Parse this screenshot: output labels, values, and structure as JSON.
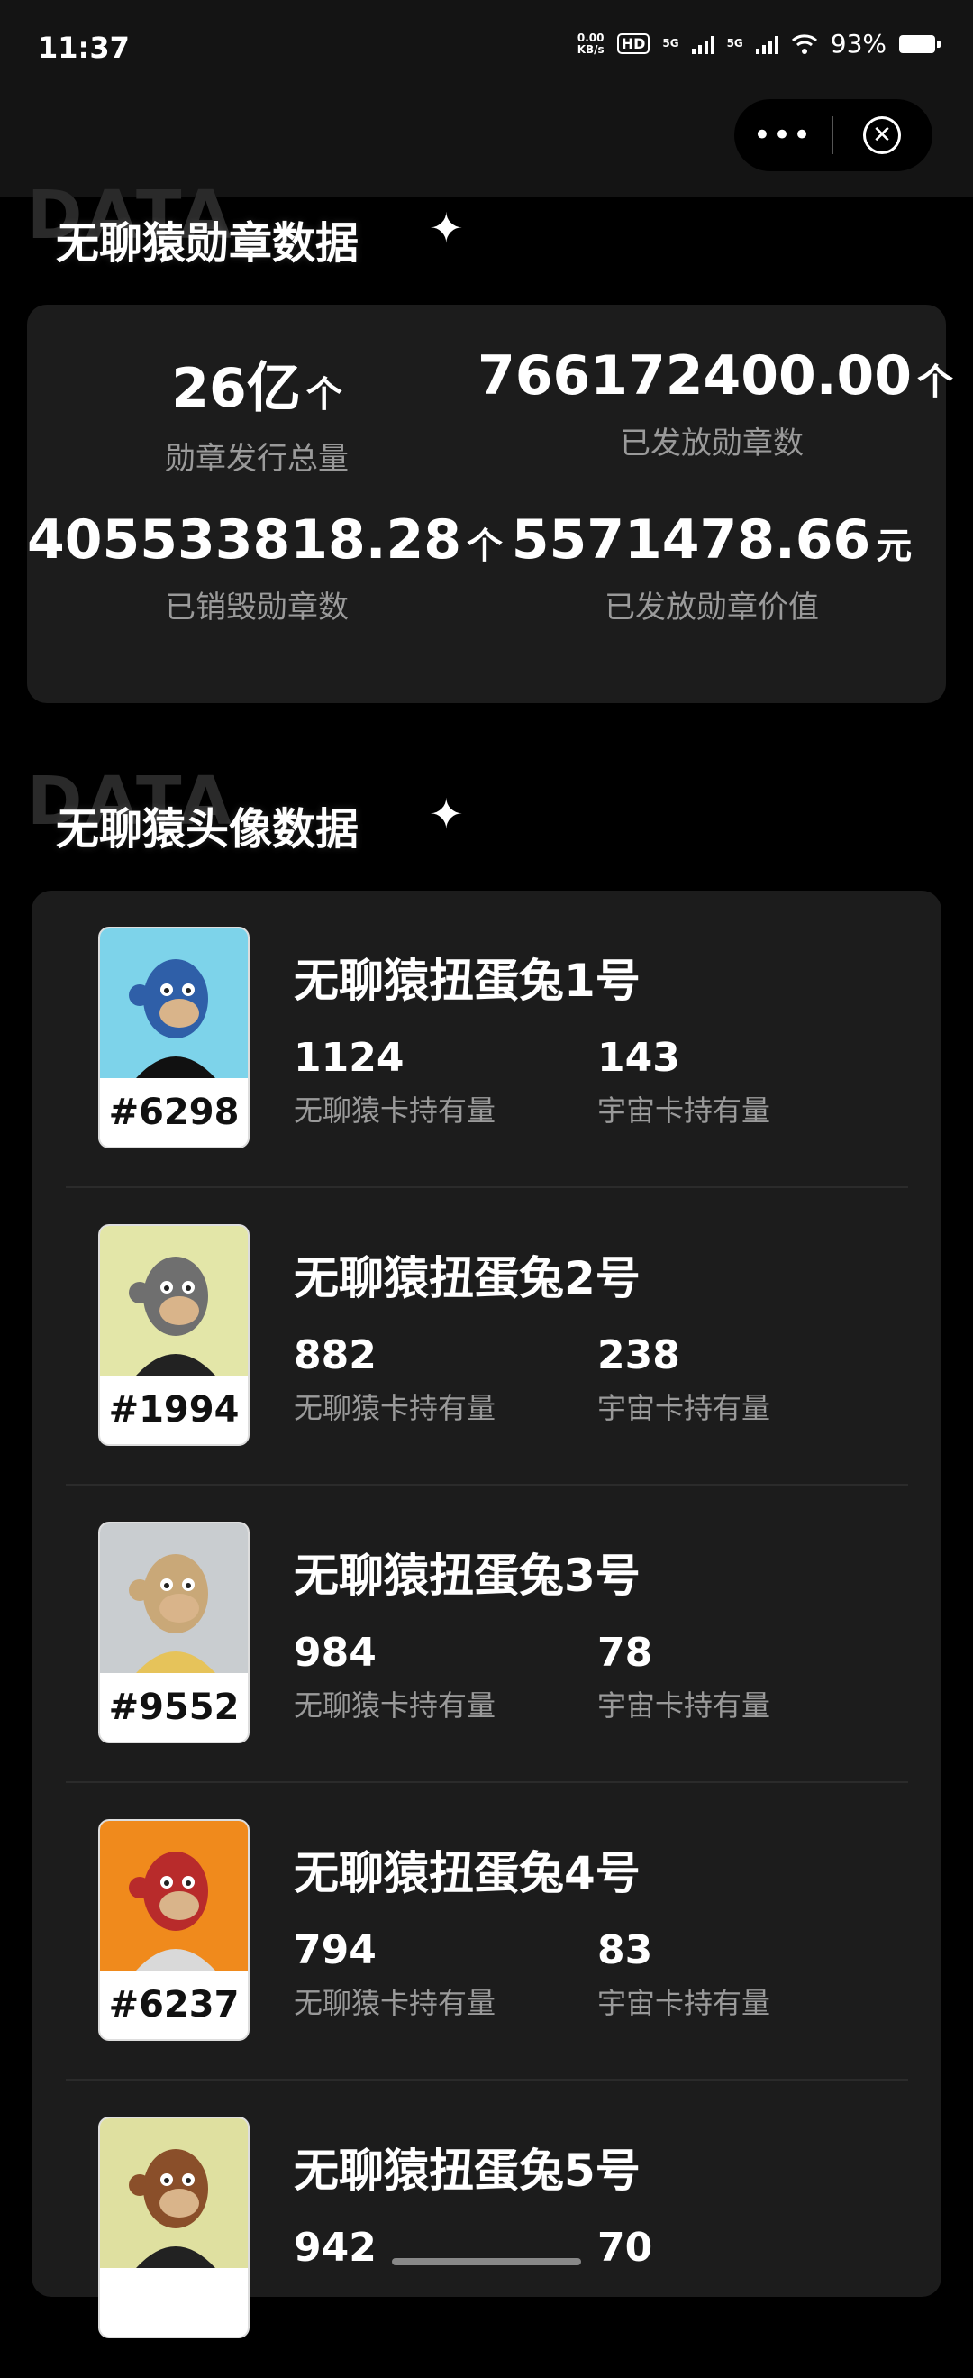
{
  "status": {
    "time": "11:37",
    "net_speed_value": "0.00",
    "net_speed_unit": "KB/s",
    "hd_label": "HD",
    "sim1_label": "5G",
    "sim2_label": "5G",
    "battery": "93%"
  },
  "nav": {
    "more_icon": "more-dots-icon",
    "close_icon": "close-circle-icon"
  },
  "badge_section": {
    "watermark": "DATA",
    "title": "无聊猿勋章数据",
    "stats": [
      {
        "value": "26亿",
        "unit": "个",
        "label": "勋章发行总量"
      },
      {
        "value": "766172400.00",
        "unit": "个",
        "label": "已发放勋章数"
      },
      {
        "value": "405533818.28",
        "unit": "个",
        "label": "已销毁勋章数"
      },
      {
        "value": "5571478.66",
        "unit": "元",
        "label": "已发放勋章价值"
      }
    ]
  },
  "avatar_section": {
    "watermark": "DATA",
    "title": "无聊猿头像数据",
    "items": [
      {
        "id": "#6298",
        "name": "无聊猿扭蛋兔1号",
        "ape_count": "1124",
        "ape_label": "无聊猿卡持有量",
        "cosmic_count": "143",
        "cosmic_label": "宇宙卡持有量",
        "bg_color": "#7dd3ea",
        "face_color": "#2f5fa8",
        "body_color": "#111111"
      },
      {
        "id": "#1994",
        "name": "无聊猿扭蛋兔2号",
        "ape_count": "882",
        "ape_label": "无聊猿卡持有量",
        "cosmic_count": "238",
        "cosmic_label": "宇宙卡持有量",
        "bg_color": "#e3e6a8",
        "face_color": "#6f6f6f",
        "body_color": "#222222"
      },
      {
        "id": "#9552",
        "name": "无聊猿扭蛋兔3号",
        "ape_count": "984",
        "ape_label": "无聊猿卡持有量",
        "cosmic_count": "78",
        "cosmic_label": "宇宙卡持有量",
        "bg_color": "#c9cdd0",
        "face_color": "#c9a878",
        "body_color": "#e6c35a"
      },
      {
        "id": "#6237",
        "name": "无聊猿扭蛋兔4号",
        "ape_count": "794",
        "ape_label": "无聊猿卡持有量",
        "cosmic_count": "83",
        "cosmic_label": "宇宙卡持有量",
        "bg_color": "#f08a1c",
        "face_color": "#b82b2b",
        "body_color": "#d9d9d9"
      },
      {
        "id": "",
        "name": "无聊猿扭蛋兔5号",
        "ape_count": "942",
        "ape_label": "",
        "cosmic_count": "70",
        "cosmic_label": "",
        "bg_color": "#dfe0a0",
        "face_color": "#8a4f2a",
        "body_color": "#222222"
      }
    ]
  }
}
